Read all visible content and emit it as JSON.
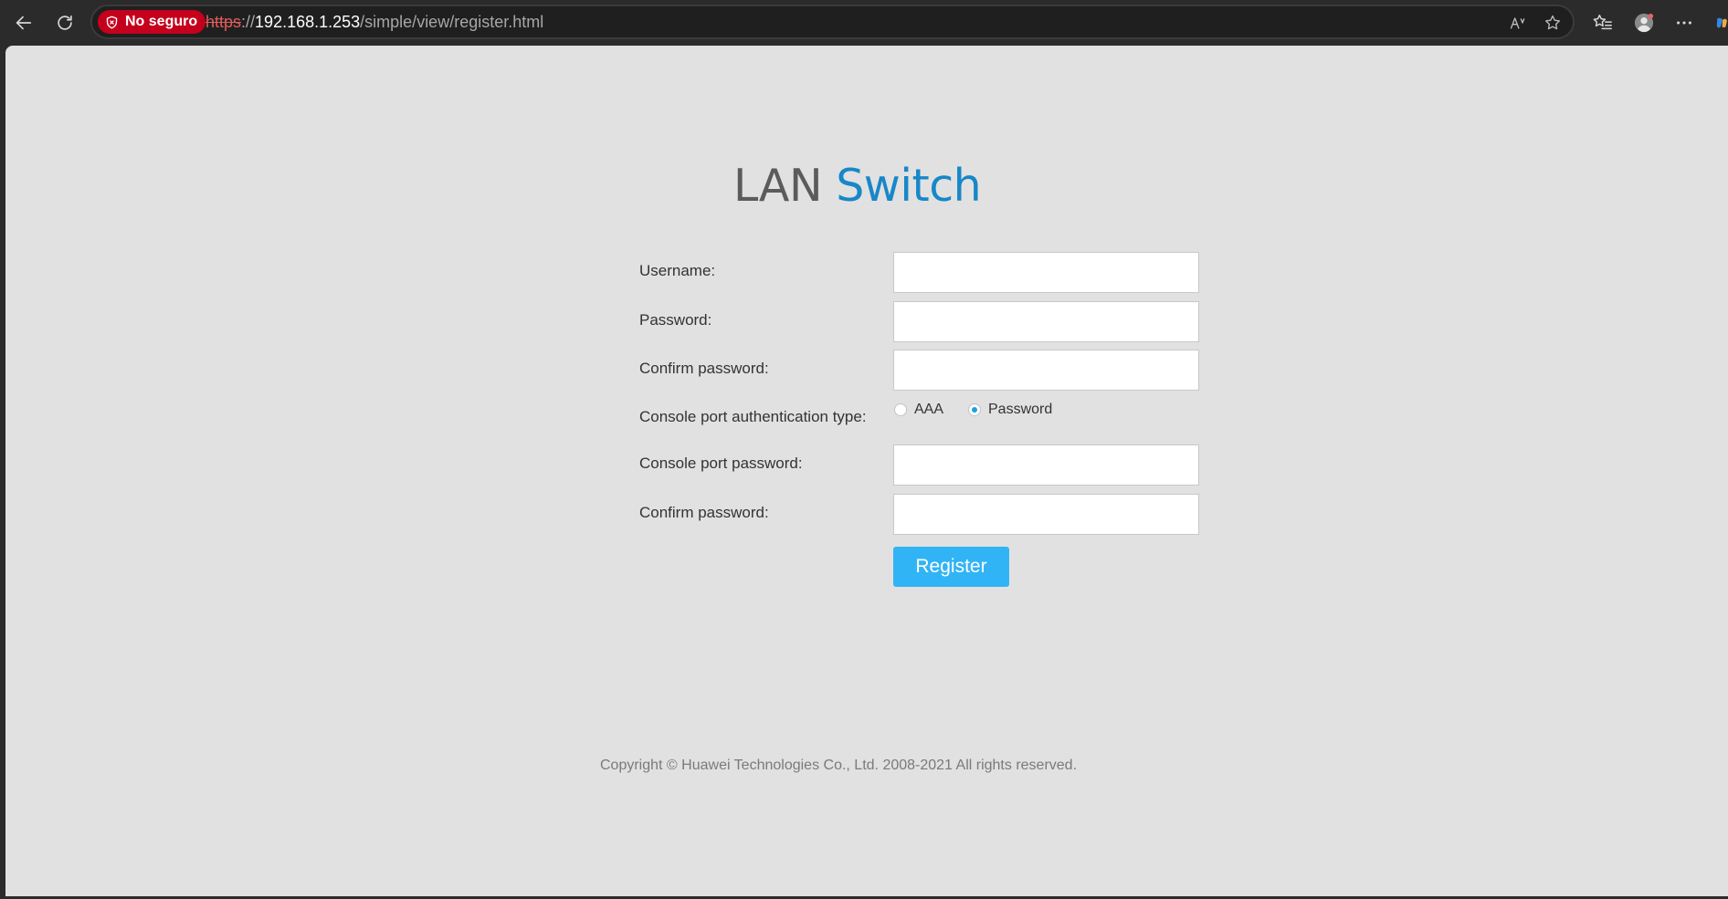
{
  "browser": {
    "security_label": "No seguro",
    "url_scheme": "https",
    "url_separator": "://",
    "url_host": "192.168.1.253",
    "url_path": "/simple/view/register.html"
  },
  "page": {
    "logo_part1": "LAN",
    "logo_part2": "Switch",
    "form": {
      "username_label": "Username:",
      "password_label": "Password:",
      "confirm_password_label": "Confirm password:",
      "auth_type_label": "Console port authentication type:",
      "auth_options": [
        {
          "label": "AAA",
          "selected": false
        },
        {
          "label": "Password",
          "selected": true
        }
      ],
      "console_password_label": "Console port password:",
      "console_confirm_label": "Confirm password:",
      "register_label": "Register"
    },
    "copyright": "Copyright © Huawei Technologies Co., Ltd. 2008-2021 All rights reserved."
  },
  "colors": {
    "security_chip": "#c4001c",
    "logo_accent": "#1787c8",
    "button": "#31b4f5",
    "radio_selected": "#1aa1e0"
  }
}
